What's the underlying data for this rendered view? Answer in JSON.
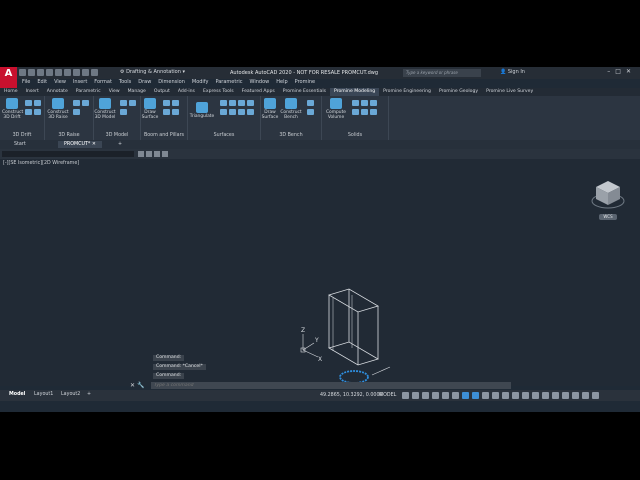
{
  "titlebar": {
    "logo": "A",
    "workspace": "Drafting & Annotation",
    "title": "Autodesk AutoCAD 2020 - NOT FOR RESALE   PROMCUT.dwg",
    "search_placeholder": "Type a keyword or phrase",
    "signin": "Sign In"
  },
  "menubar": [
    "File",
    "Edit",
    "View",
    "Insert",
    "Format",
    "Tools",
    "Draw",
    "Dimension",
    "Modify",
    "Parametric",
    "Window",
    "Help",
    "Promine"
  ],
  "ribbon_tabs": [
    "Home",
    "Insert",
    "Annotate",
    "Parametric",
    "View",
    "Manage",
    "Output",
    "Add-ins",
    "Express Tools",
    "Featured Apps",
    "Promine Essentials",
    "Promine Modeling",
    "Promine Engineering",
    "Promine Geology",
    "Promine Live Survey"
  ],
  "active_tab": "Promine Modeling",
  "panels": {
    "drift": {
      "title": "3D Drift",
      "construct": "Construct",
      "sub": "3D Drift"
    },
    "raise": {
      "title": "3D Raise",
      "construct": "Construct",
      "sub": "3D Raise"
    },
    "model": {
      "title": "3D Model",
      "construct": "Construct",
      "sub": "3D Model"
    },
    "boom": {
      "title": "Boom and Pillars",
      "draw": "Draw",
      "sub": "Surface"
    },
    "surfaces": {
      "title": "Surfaces",
      "triangulate": "Triangulate"
    },
    "bench": {
      "title": "3D Bench",
      "draw": "Draw",
      "draw_sub": "Surface",
      "construct": "Construct",
      "construct_sub": "Bench"
    },
    "solids": {
      "title": "Solids",
      "compute": "Compute",
      "compute_sub": "Volume"
    }
  },
  "doc_tabs": {
    "start": "Start",
    "file": "PROMCUT*"
  },
  "viewport": {
    "label": "[-][SE Isometric][2D Wireframe]",
    "wcs": "WCS"
  },
  "command_history": [
    "Command:",
    "Command: *Cancel*",
    "Command:"
  ],
  "command_placeholder": "Type a command",
  "status": {
    "layouts": [
      "Model",
      "Layout1",
      "Layout2"
    ],
    "coords": "49.2865, 10.3292, 0.0000",
    "space": "MODEL"
  },
  "colors": {
    "accent": "#3d8fd6",
    "viewport_bg": "#212a35",
    "model_lines": "#d9dde2",
    "selection": "#2f8fe0"
  }
}
